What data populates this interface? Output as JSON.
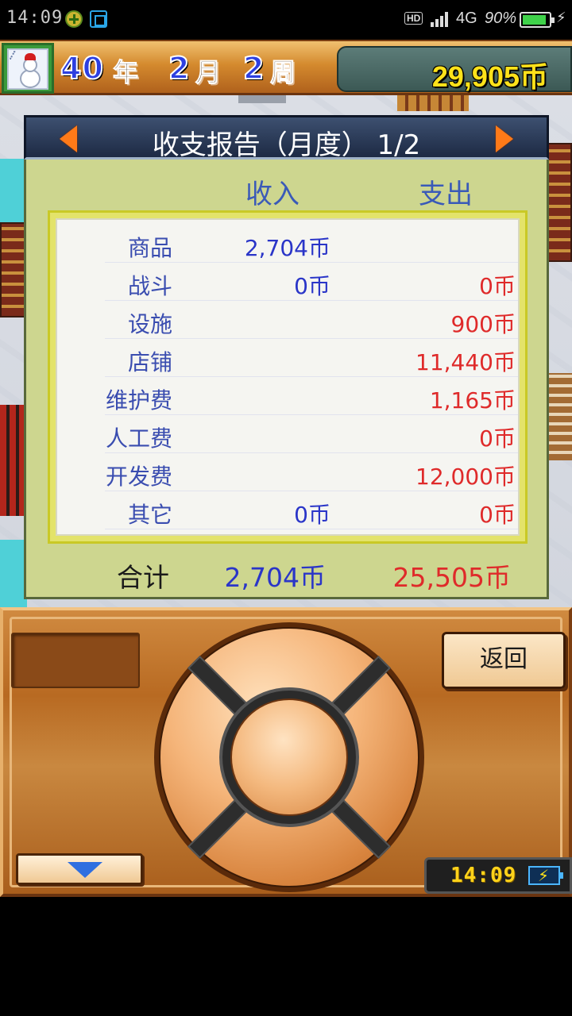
{
  "status_bar": {
    "time": "14:09",
    "hd": "HD",
    "network": "4G",
    "battery_text": "90%",
    "battery_level": 0.9,
    "icons": [
      "plus-circle-icon",
      "screenshot-icon",
      "signal-icon",
      "battery-icon",
      "charging-icon"
    ]
  },
  "hud": {
    "year_num": "40",
    "year_unit": "年",
    "month_num": "2",
    "month_unit": "月",
    "week_num": "2",
    "week_unit": "周",
    "money": "29,905币"
  },
  "report": {
    "title": "收支报告（月度） 1/2",
    "col_income": "收入",
    "col_expense": "支出",
    "rows": [
      {
        "label": "商品",
        "income": "2,704币",
        "expense": ""
      },
      {
        "label": "战斗",
        "income": "0币",
        "expense": "0币"
      },
      {
        "label": "设施",
        "income": "",
        "expense": "900币"
      },
      {
        "label": "店铺",
        "income": "",
        "expense": "11,440币"
      },
      {
        "label": "维护费",
        "income": "",
        "expense": "1,165币"
      },
      {
        "label": "人工费",
        "income": "",
        "expense": "0币"
      },
      {
        "label": "开发费",
        "income": "",
        "expense": "12,000币"
      },
      {
        "label": "其它",
        "income": "0币",
        "expense": "0币"
      }
    ],
    "total_label": "合计",
    "total_income": "2,704币",
    "total_expense": "25,505币",
    "colors": {
      "income": "#2a35c8",
      "expense": "#df2a2a",
      "label": "#3a4db0"
    }
  },
  "controls": {
    "back_label": "返回",
    "clock": "14:09"
  }
}
